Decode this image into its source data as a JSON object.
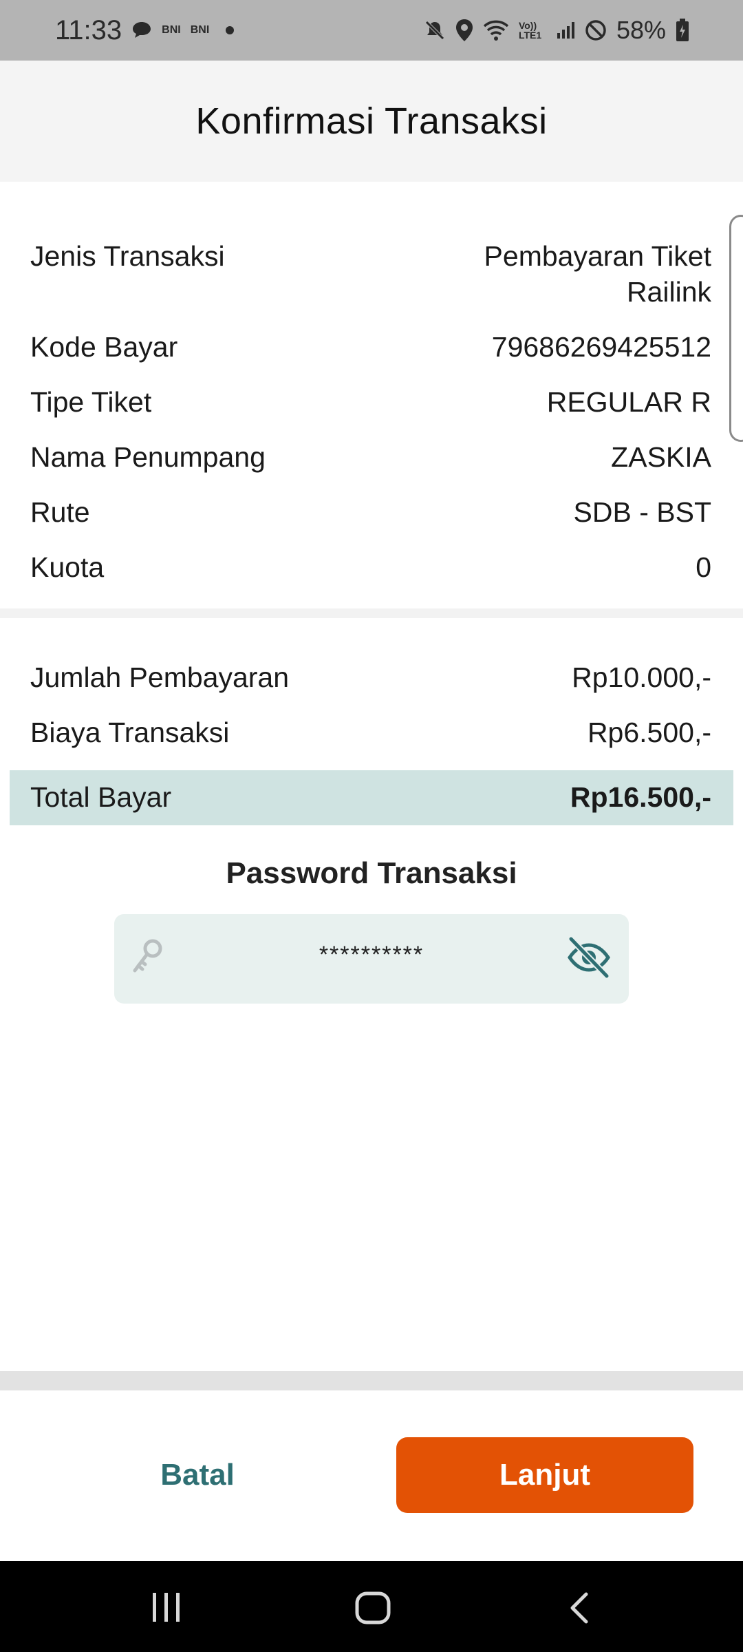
{
  "status_bar": {
    "time": "11:33",
    "notif_1": "BNI",
    "notif_2": "BNI",
    "network_label": "Vo)) LTE1",
    "battery": "58%"
  },
  "header": {
    "title": "Konfirmasi Transaksi"
  },
  "details": {
    "rows": [
      {
        "label": "Jenis Transaksi",
        "value_line1": "Pembayaran Tiket",
        "value_line2": "Railink"
      },
      {
        "label": "Kode Bayar",
        "value": "79686269425512"
      },
      {
        "label": "Tipe Tiket",
        "value": "REGULAR R"
      },
      {
        "label": "Nama Penumpang",
        "value": "ZASKIA"
      },
      {
        "label": "Rute",
        "value": "SDB - BST"
      },
      {
        "label": "Kuota",
        "value": "0"
      }
    ]
  },
  "payment": {
    "rows": [
      {
        "label": "Jumlah Pembayaran",
        "value": "Rp10.000,-"
      },
      {
        "label": "Biaya Transaksi",
        "value": "Rp6.500,-"
      }
    ],
    "total": {
      "label": "Total Bayar",
      "value": "Rp16.500,-"
    }
  },
  "password": {
    "title": "Password Transaksi",
    "value": "**********"
  },
  "actions": {
    "cancel_label": "Batal",
    "next_label": "Lanjut"
  },
  "colors": {
    "accent_orange": "#e35205",
    "teal_text": "#2e6f73",
    "total_highlight": "#cfe3e1",
    "field_bg": "#e8f1ef"
  }
}
